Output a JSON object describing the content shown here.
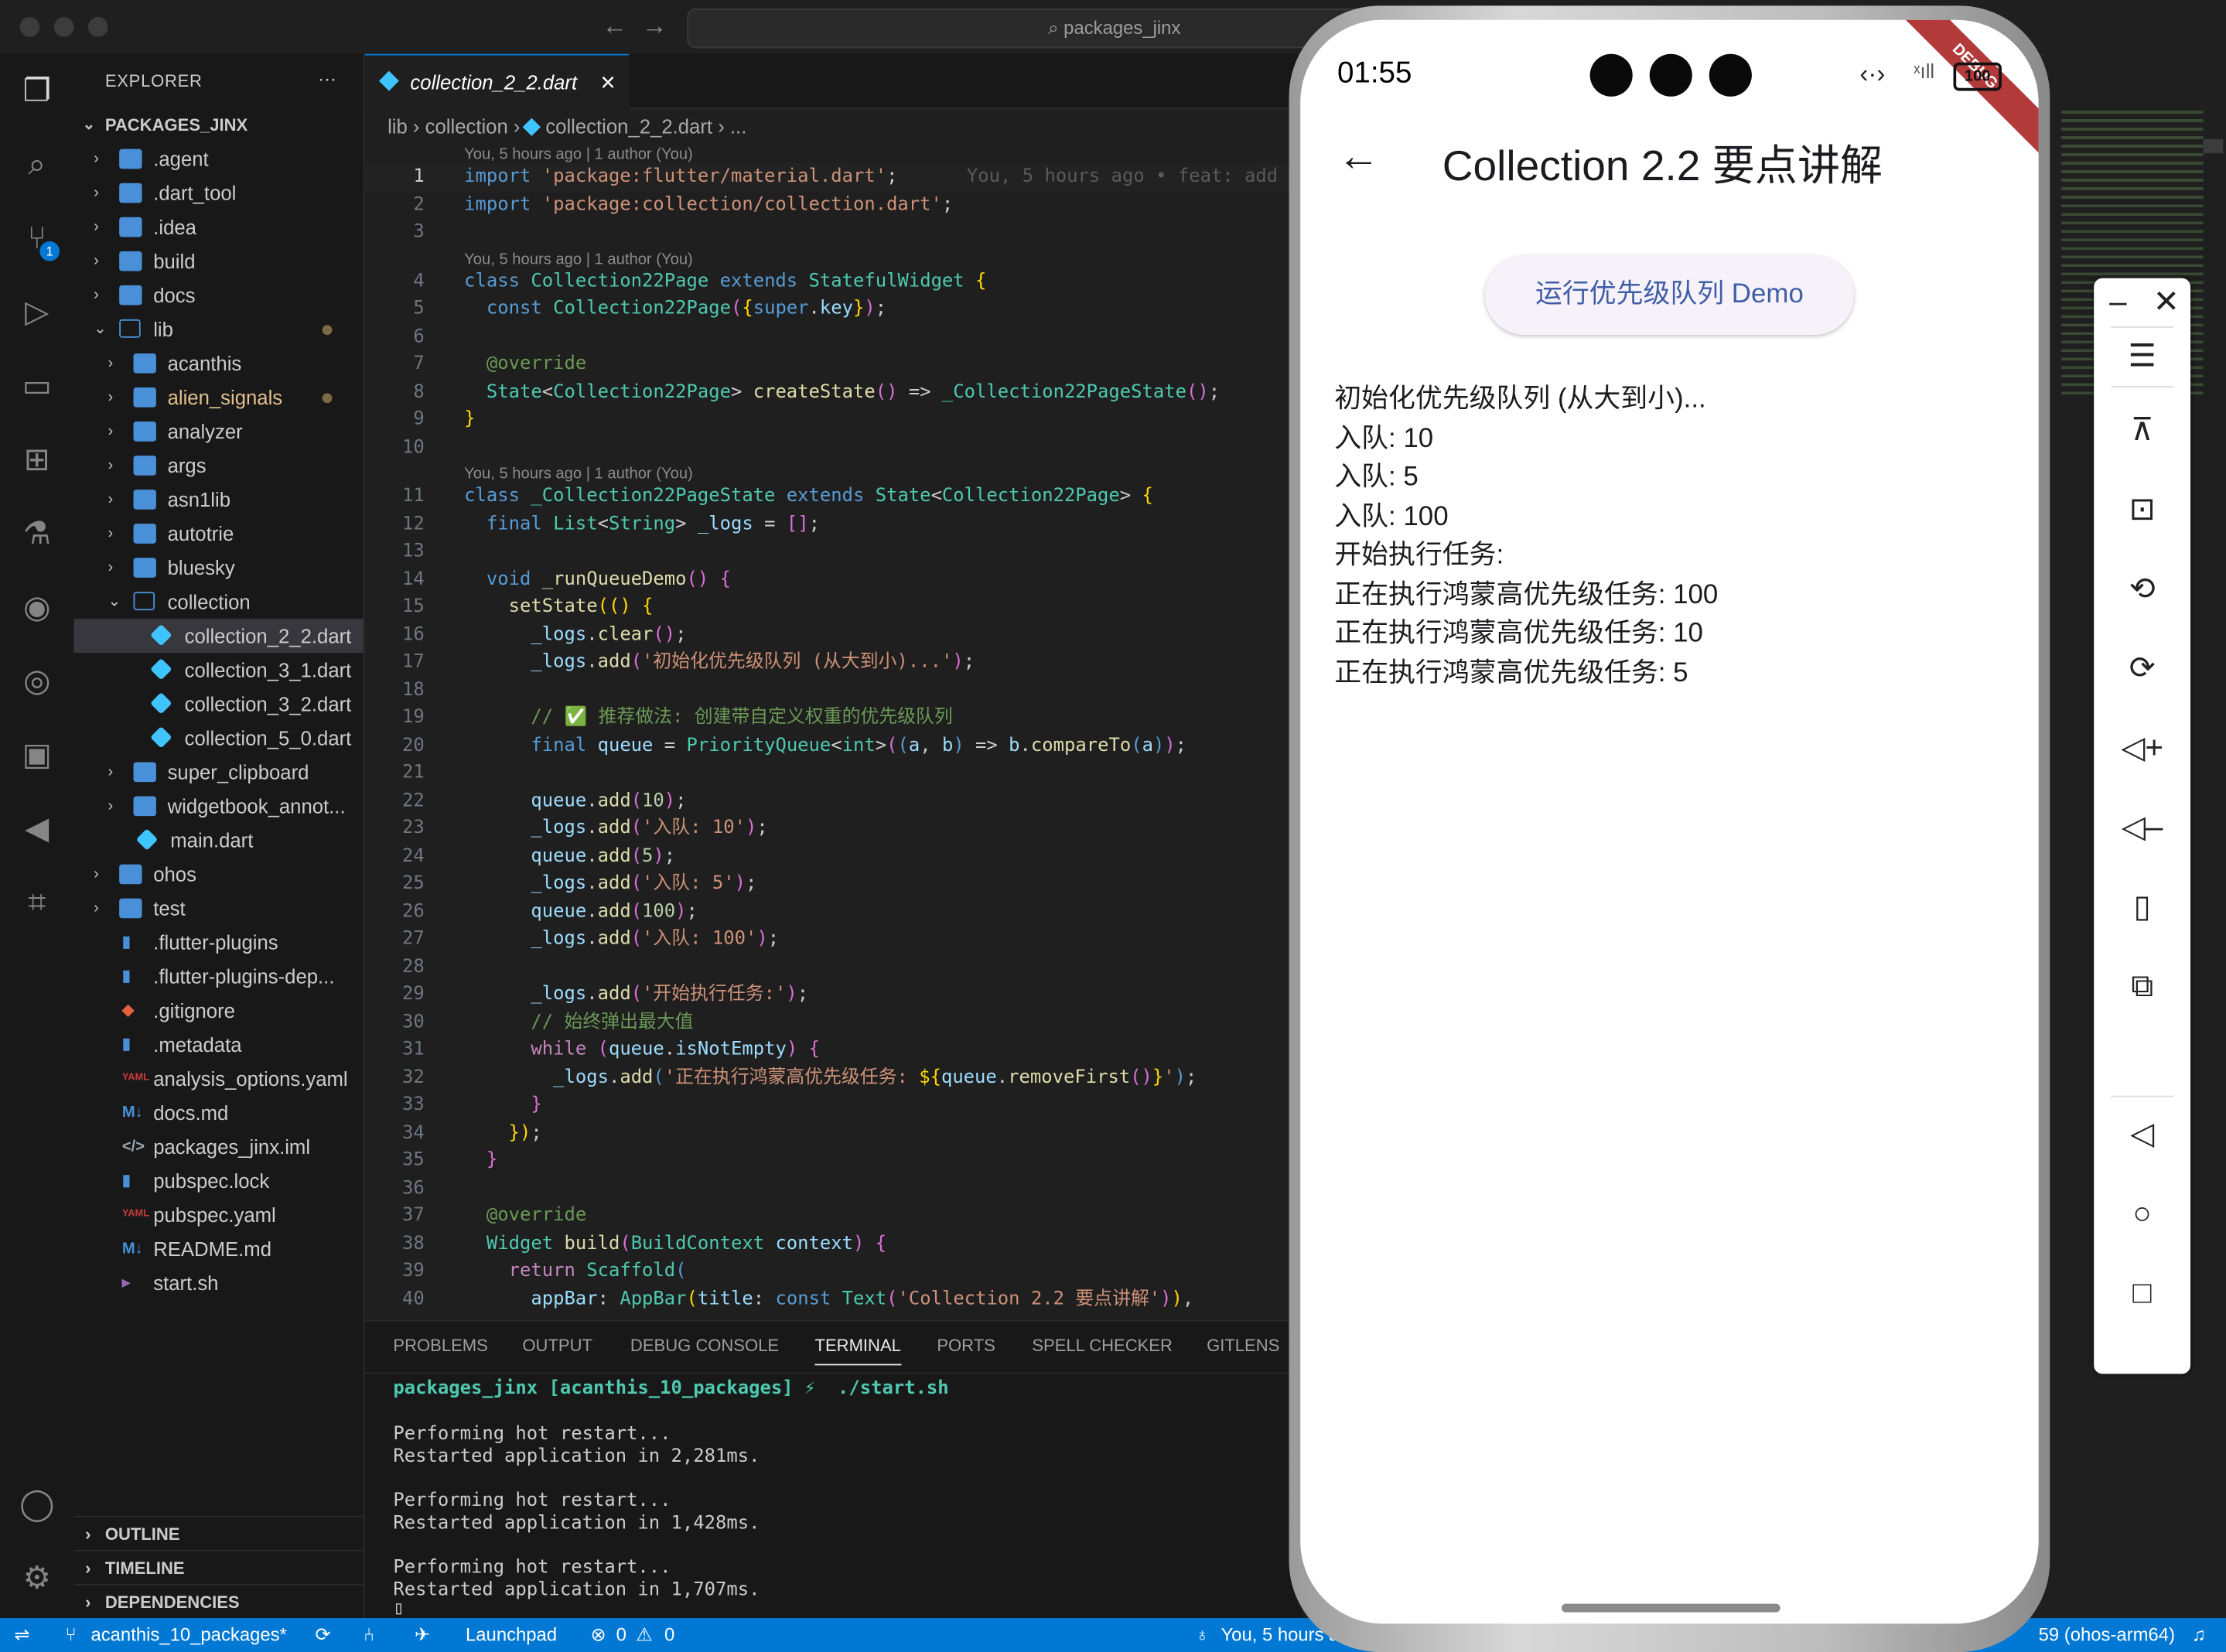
{
  "window": {
    "search": "packages_jinx"
  },
  "explorer": {
    "title": "EXPLORER",
    "more": "···",
    "root": "PACKAGES_JINX",
    "items": [
      {
        "label": ".agent",
        "depth": 0,
        "kind": "folder",
        "open": false
      },
      {
        "label": ".dart_tool",
        "depth": 0,
        "kind": "folder",
        "open": false
      },
      {
        "label": ".idea",
        "depth": 0,
        "kind": "folder",
        "open": false
      },
      {
        "label": "build",
        "depth": 0,
        "kind": "folder",
        "open": false
      },
      {
        "label": "docs",
        "depth": 0,
        "kind": "folder",
        "open": false
      },
      {
        "label": "lib",
        "depth": 0,
        "kind": "folder",
        "open": true
      },
      {
        "label": "acanthis",
        "depth": 1,
        "kind": "folder",
        "open": false
      },
      {
        "label": "alien_signals",
        "depth": 1,
        "kind": "folder",
        "open": false
      },
      {
        "label": "analyzer",
        "depth": 1,
        "kind": "folder",
        "open": false
      },
      {
        "label": "args",
        "depth": 1,
        "kind": "folder",
        "open": false
      },
      {
        "label": "asn1lib",
        "depth": 1,
        "kind": "folder",
        "open": false
      },
      {
        "label": "autotrie",
        "depth": 1,
        "kind": "folder",
        "open": false
      },
      {
        "label": "bluesky",
        "depth": 1,
        "kind": "folder",
        "open": false
      },
      {
        "label": "collection",
        "depth": 1,
        "kind": "folder",
        "open": true
      },
      {
        "label": "collection_2_2.dart",
        "depth": 2,
        "kind": "dart"
      },
      {
        "label": "collection_3_1.dart",
        "depth": 2,
        "kind": "dart"
      },
      {
        "label": "collection_3_2.dart",
        "depth": 2,
        "kind": "dart"
      },
      {
        "label": "collection_5_0.dart",
        "depth": 2,
        "kind": "dart"
      },
      {
        "label": "super_clipboard",
        "depth": 1,
        "kind": "folder",
        "open": false
      },
      {
        "label": "widgetbook_annot...",
        "depth": 1,
        "kind": "folder",
        "open": false
      },
      {
        "label": "main.dart",
        "depth": 1,
        "kind": "dart"
      },
      {
        "label": "ohos",
        "depth": 0,
        "kind": "folder",
        "open": false
      },
      {
        "label": "test",
        "depth": 0,
        "kind": "folder",
        "open": false
      },
      {
        "label": ".flutter-plugins",
        "depth": 0,
        "kind": "file"
      },
      {
        "label": ".flutter-plugins-dep...",
        "depth": 0,
        "kind": "file"
      },
      {
        "label": ".gitignore",
        "depth": 0,
        "kind": "git"
      },
      {
        "label": ".metadata",
        "depth": 0,
        "kind": "file"
      },
      {
        "label": "analysis_options.yaml",
        "depth": 0,
        "kind": "yaml"
      },
      {
        "label": "docs.md",
        "depth": 0,
        "kind": "md"
      },
      {
        "label": "packages_jinx.iml",
        "depth": 0,
        "kind": "xml"
      },
      {
        "label": "pubspec.lock",
        "depth": 0,
        "kind": "file"
      },
      {
        "label": "pubspec.yaml",
        "depth": 0,
        "kind": "yaml"
      },
      {
        "label": "README.md",
        "depth": 0,
        "kind": "md"
      },
      {
        "label": "start.sh",
        "depth": 0,
        "kind": "sh"
      }
    ],
    "sections": [
      "OUTLINE",
      "TIMELINE",
      "DEPENDENCIES"
    ]
  },
  "editor": {
    "tab": "collection_2_2.dart",
    "tab_close": "×",
    "breadcrumb": [
      "lib",
      "collection",
      "collection_2_2.dart",
      "..."
    ],
    "blame": "You, 5 hours ago | 1 author (You)",
    "inline_blame": "You, 5 hours ago • feat: add",
    "lines": [
      {
        "n": "1",
        "blame": true,
        "html": "<span class='k'>import</span> <span class='s'>'package:flutter/material.dart'</span>;"
      },
      {
        "n": "2",
        "html": "<span class='k'>import</span> <span class='s'>'package:collection/collection.dart'</span>;"
      },
      {
        "n": "3",
        "html": ""
      },
      {
        "n": "4",
        "blame": true,
        "html": "<span class='k'>class</span> <span class='t'>Collection22Page</span> <span class='k'>extends</span> <span class='t'>StatefulWidget</span> <span class='p'>{</span>"
      },
      {
        "n": "5",
        "html": "  <span class='k'>const</span> <span class='t'>Collection22Page</span><span class='p2'>(</span><span class='p'>{</span><span class='k'>super</span>.<span class='v'>key</span><span class='p'>}</span><span class='p2'>)</span>;"
      },
      {
        "n": "6",
        "html": ""
      },
      {
        "n": "7",
        "html": "  <span class='c'>@override</span>"
      },
      {
        "n": "8",
        "html": "  <span class='t'>State</span>&lt;<span class='t'>Collection22Page</span>&gt; <span class='f'>createState</span><span class='p2'>()</span> =&gt; <span class='t'>_Collection22PageState</span><span class='p2'>()</span>;"
      },
      {
        "n": "9",
        "html": "<span class='p'>}</span>"
      },
      {
        "n": "10",
        "html": ""
      },
      {
        "n": "11",
        "blame": true,
        "html": "<span class='k'>class</span> <span class='t'>_Collection22PageState</span> <span class='k'>extends</span> <span class='t'>State</span>&lt;<span class='t'>Collection22Page</span>&gt; <span class='p'>{</span>"
      },
      {
        "n": "12",
        "html": "  <span class='k'>final</span> <span class='t'>List</span>&lt;<span class='t'>String</span>&gt; <span class='v'>_logs</span> = <span class='p2'>[]</span>;"
      },
      {
        "n": "13",
        "html": ""
      },
      {
        "n": "14",
        "html": "  <span class='k'>void</span> <span class='f'>_runQueueDemo</span><span class='p2'>()</span> <span class='p2'>{</span>"
      },
      {
        "n": "15",
        "html": "    <span class='f'>setState</span><span class='p'>((</span><span class='p'>)</span> <span class='p'>{</span>"
      },
      {
        "n": "16",
        "html": "      <span class='v'>_logs</span>.<span class='f'>clear</span><span class='p2'>()</span>;"
      },
      {
        "n": "17",
        "html": "      <span class='v'>_logs</span>.<span class='f'>add</span><span class='p2'>(</span><span class='s'>'初始化优先级队列 (从大到小)...'</span><span class='p2'>)</span>;"
      },
      {
        "n": "18",
        "html": ""
      },
      {
        "n": "19",
        "html": "      <span class='c'>// ✅ 推荐做法: 创建带自定义权重的优先级队列</span>"
      },
      {
        "n": "20",
        "html": "      <span class='k'>final</span> <span class='v'>queue</span> = <span class='t'>PriorityQueue</span>&lt;<span class='t'>int</span>&gt;<span class='p2'>(</span><span class='k'>(</span><span class='v'>a</span>, <span class='v'>b</span><span class='k'>)</span> =&gt; <span class='v'>b</span>.<span class='f'>compareTo</span><span class='k'>(</span><span class='v'>a</span><span class='k'>)</span><span class='p2'>)</span>;"
      },
      {
        "n": "21",
        "html": ""
      },
      {
        "n": "22",
        "html": "      <span class='v'>queue</span>.<span class='f'>add</span><span class='p2'>(</span><span class='n'>10</span><span class='p2'>)</span>;"
      },
      {
        "n": "23",
        "html": "      <span class='v'>_logs</span>.<span class='f'>add</span><span class='p2'>(</span><span class='s'>'入队: 10'</span><span class='p2'>)</span>;"
      },
      {
        "n": "24",
        "html": "      <span class='v'>queue</span>.<span class='f'>add</span><span class='p2'>(</span><span class='n'>5</span><span class='p2'>)</span>;"
      },
      {
        "n": "25",
        "html": "      <span class='v'>_logs</span>.<span class='f'>add</span><span class='p2'>(</span><span class='s'>'入队: 5'</span><span class='p2'>)</span>;"
      },
      {
        "n": "26",
        "html": "      <span class='v'>queue</span>.<span class='f'>add</span><span class='p2'>(</span><span class='n'>100</span><span class='p2'>)</span>;"
      },
      {
        "n": "27",
        "html": "      <span class='v'>_logs</span>.<span class='f'>add</span><span class='p2'>(</span><span class='s'>'入队: 100'</span><span class='p2'>)</span>;"
      },
      {
        "n": "28",
        "html": ""
      },
      {
        "n": "29",
        "html": "      <span class='v'>_logs</span>.<span class='f'>add</span><span class='p2'>(</span><span class='s'>'开始执行任务:'</span><span class='p2'>)</span>;"
      },
      {
        "n": "30",
        "html": "      <span class='c'>// 始终弹出最大值</span>"
      },
      {
        "n": "31",
        "html": "      <span class='kw'>while</span> <span class='p2'>(</span><span class='v'>queue</span>.<span class='v'>isNotEmpty</span><span class='p2'>)</span> <span class='p2'>{</span>"
      },
      {
        "n": "32",
        "html": "        <span class='v'>_logs</span>.<span class='f'>add</span><span class='k'>(</span><span class='s'>'正在执行鸿蒙高优先级任务: </span><span class='p'>${</span><span class='v'>queue</span>.<span class='f'>removeFirst</span><span class='p2'>()</span><span class='p'>}</span><span class='s'>'</span><span class='k'>)</span>;"
      },
      {
        "n": "33",
        "html": "      <span class='p2'>}</span>"
      },
      {
        "n": "34",
        "html": "    <span class='p'>})</span>;"
      },
      {
        "n": "35",
        "html": "  <span class='p2'>}</span>"
      },
      {
        "n": "36",
        "html": ""
      },
      {
        "n": "37",
        "html": "  <span class='c'>@override</span>"
      },
      {
        "n": "38",
        "html": "  <span class='t'>Widget</span> <span class='f'>build</span><span class='p2'>(</span><span class='t'>BuildContext</span> <span class='v'>context</span><span class='p2'>)</span> <span class='p2'>{</span>"
      },
      {
        "n": "39",
        "html": "    <span class='kw'>return</span> <span class='t'>Scaffold</span><span class='k'>(</span>"
      },
      {
        "n": "40",
        "html": "      <span class='v'>appBar</span>: <span class='t'>AppBar</span><span class='p'>(</span><span class='v'>title</span>: <span class='k'>const</span> <span class='t'>Text</span><span class='p2'>(</span><span class='s'>'Collection 2.2 要点讲解'</span><span class='p2'>)</span><span class='p'>)</span>,"
      }
    ]
  },
  "panel": {
    "tabs": [
      "PROBLEMS",
      "OUTPUT",
      "DEBUG CONSOLE",
      "TERMINAL",
      "PORTS",
      "SPELL CHECKER",
      "GITLENS"
    ],
    "active_tab": "TERMINAL",
    "prompt": "packages_jinx [acanthis_10_packages] ⚡  ./start.sh",
    "output": [
      "Performing hot restart...",
      "Restarted application in 2,281ms.",
      "",
      "Performing hot restart...",
      "Restarted application in 1,428ms.",
      "",
      "Performing hot restart...",
      "Restarted application in 1,707ms."
    ]
  },
  "statusbar": {
    "branch": "acanthis_10_packages*",
    "launchpad": "Launchpad",
    "errors": "0",
    "warnings": "0",
    "blame": "You, 5 hours a",
    "device": "59 (ohos-arm64)"
  },
  "phone": {
    "time": "01:55",
    "battery": "100",
    "debug_banner": "DEBUG",
    "app_title": "Collection 2.2 要点讲解",
    "button": "运行优先级队列 Demo",
    "logs": [
      "初始化优先级队列 (从大到小)...",
      "入队: 10",
      "入队: 5",
      "入队: 100",
      "开始执行任务:",
      "正在执行鸿蒙高优先级任务: 100",
      "正在执行鸿蒙高优先级任务: 10",
      "正在执行鸿蒙高优先级任务: 5"
    ]
  },
  "emulator_toolbar": {
    "items": [
      "minimize",
      "close",
      "menu",
      "pin",
      "crop",
      "rotate-left",
      "rotate-right",
      "volume-up",
      "volume-down",
      "rotate-device",
      "multi-window",
      "back",
      "home",
      "recents"
    ]
  },
  "colors": {
    "accent": "#0078d4",
    "folder": "#4a90d9",
    "dart": "#40c4ff",
    "debug": "#b33a3a"
  }
}
